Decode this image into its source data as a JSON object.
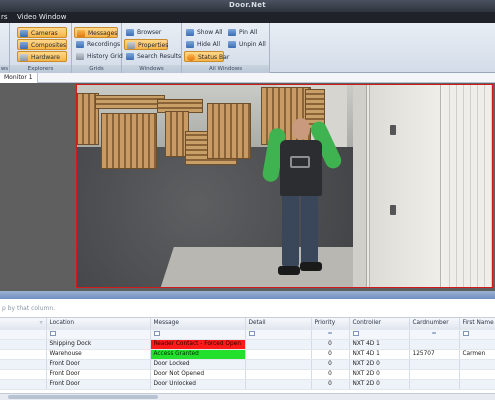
{
  "window": {
    "title": "Door.Net"
  },
  "menu": {
    "items": [
      "rs",
      "Video Window"
    ]
  },
  "ribbon": {
    "groups": [
      {
        "label": "ws",
        "buttons": []
      },
      {
        "label": "Explorers",
        "buttons": [
          "Cameras",
          "Composites",
          "Hardware"
        ]
      },
      {
        "label": "Grids",
        "buttons": [
          "Messages",
          "Recordings",
          "History Grid"
        ]
      },
      {
        "label": "Windows",
        "buttons": [
          "Browser",
          "Properties",
          "Search Results"
        ]
      },
      {
        "label": "All Windows",
        "buttons": [
          "Show All",
          "Hide All",
          "Status Bar",
          "Pin All",
          "Unpin All"
        ]
      }
    ]
  },
  "monitor": {
    "tab": "Monitor 1"
  },
  "grid": {
    "group_hint": "p by that column.",
    "columns": [
      "",
      "Location",
      "Message",
      "Detail",
      "Priority",
      "Controller",
      "Cardnumber",
      "First Name"
    ],
    "filter_ops": [
      "",
      "",
      "",
      "",
      "=",
      "",
      "=",
      ""
    ],
    "rows": [
      {
        "location": "Shipping Dock",
        "message": "Reader Contact - Forced Open",
        "detail": "",
        "priority": "0",
        "controller": "NXT 4D 1",
        "card": "",
        "first": "",
        "status": "red"
      },
      {
        "location": "Warehouse",
        "message": "Access Granted",
        "detail": "",
        "priority": "0",
        "controller": "NXT 4D 1",
        "card": "125707",
        "first": "Carmen",
        "status": "green"
      },
      {
        "location": "Front Door",
        "message": "Door Locked",
        "detail": "",
        "priority": "0",
        "controller": "NXT 2D 0",
        "card": "",
        "first": "",
        "status": ""
      },
      {
        "location": "Front Door",
        "message": "Door Not Opened",
        "detail": "",
        "priority": "0",
        "controller": "NXT 2D 0",
        "card": "",
        "first": "",
        "status": ""
      },
      {
        "location": "Front Door",
        "message": "Door Unlocked",
        "detail": "",
        "priority": "0",
        "controller": "NXT 2D 0",
        "card": "",
        "first": "",
        "status": ""
      }
    ]
  },
  "colors": {
    "accent_orange": "#f7b548",
    "alert_red": "#ff1a1a",
    "granted_green": "#22e02c",
    "video_border": "#d11a1a"
  }
}
